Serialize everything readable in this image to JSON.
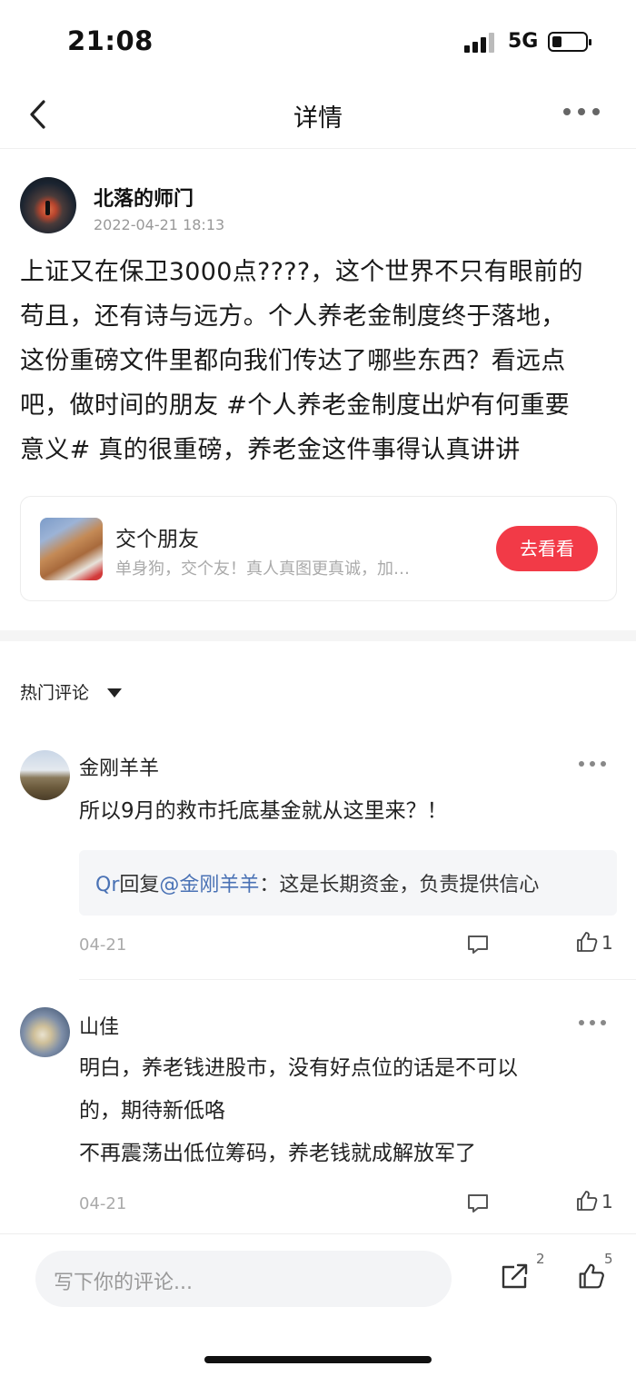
{
  "status_bar": {
    "time": "21:08",
    "network": "5G",
    "battery_level": 0.28
  },
  "nav": {
    "title": "详情"
  },
  "post": {
    "author": "北落的师门",
    "date": "2022-04-21 18:13",
    "lines": [
      "上证又在保卫3000点????，这个世界不只有眼前的",
      "苟且，还有诗与远方。个人养老金制度终于落地，",
      "这份重磅文件里都向我们传达了哪些东西？看远点",
      "吧，做时间的朋友 #个人养老金制度出炉有何重要",
      "意义# 真的很重磅，养老金这件事得认真讲讲"
    ]
  },
  "card": {
    "title": "交个朋友",
    "subtitle": "单身狗，交个友！真人真图更真诚，加…",
    "button": "去看看",
    "button_color": "#f23a47"
  },
  "comments_header": {
    "label": "热门评论"
  },
  "comments": [
    {
      "name": "金刚羊羊",
      "text": "所以9月的救市托底基金就从这里来？！",
      "reply": {
        "user": "Qr",
        "verb": "回复",
        "target": "@金刚羊羊",
        "text": "：这是长期资金，负责提供信心"
      },
      "date": "04-21",
      "likes": "1"
    },
    {
      "name": "山佳",
      "lines": [
        "明白，养老钱进股市，没有好点位的话是不可以",
        "的，期待新低咯",
        "不再震荡出低位筹码，养老钱就成解放军了"
      ],
      "date": "04-21",
      "likes": "1"
    }
  ],
  "bottom_bar": {
    "placeholder": "写下你的评论...",
    "share_count": "2",
    "like_count": "5"
  }
}
